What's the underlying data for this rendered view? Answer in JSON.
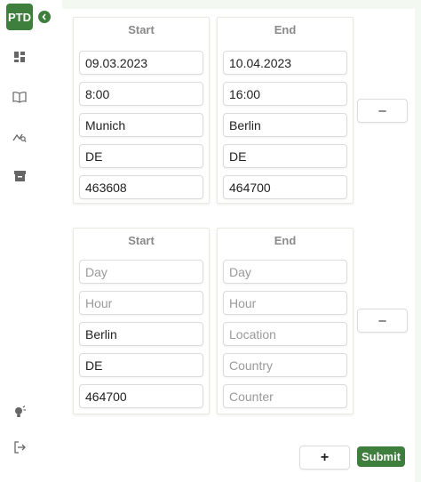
{
  "sidebar": {
    "logo_text": "PTD",
    "collapse_icon": "chevron-left-icon",
    "nav_icons": [
      "dashboard-icon",
      "book-icon",
      "analytics-icon",
      "archive-icon"
    ],
    "bottom_icons": [
      "lightbulb-icon",
      "logout-icon"
    ]
  },
  "trips": [
    {
      "start": {
        "title": "Start",
        "day": {
          "value": "09.03.2023",
          "placeholder": "Day"
        },
        "hour": {
          "value": "8:00",
          "placeholder": "Hour"
        },
        "location": {
          "value": "Munich",
          "placeholder": "Location"
        },
        "country": {
          "value": "DE",
          "placeholder": "Country"
        },
        "counter": {
          "value": "463608",
          "placeholder": "Counter"
        }
      },
      "end": {
        "title": "End",
        "day": {
          "value": "10.04.2023",
          "placeholder": "Day"
        },
        "hour": {
          "value": "16:00",
          "placeholder": "Hour"
        },
        "location": {
          "value": "Berlin",
          "placeholder": "Location"
        },
        "country": {
          "value": "DE",
          "placeholder": "Country"
        },
        "counter": {
          "value": "464700",
          "placeholder": "Counter"
        }
      },
      "remove_label": "–"
    },
    {
      "start": {
        "title": "Start",
        "day": {
          "value": "",
          "placeholder": "Day"
        },
        "hour": {
          "value": "",
          "placeholder": "Hour"
        },
        "location": {
          "value": "Berlin",
          "placeholder": "Location"
        },
        "country": {
          "value": "DE",
          "placeholder": "Country"
        },
        "counter": {
          "value": "464700",
          "placeholder": "Counter"
        }
      },
      "end": {
        "title": "End",
        "day": {
          "value": "",
          "placeholder": "Day"
        },
        "hour": {
          "value": "",
          "placeholder": "Hour"
        },
        "location": {
          "value": "",
          "placeholder": "Location"
        },
        "country": {
          "value": "",
          "placeholder": "Country"
        },
        "counter": {
          "value": "",
          "placeholder": "Counter"
        }
      },
      "remove_label": "–"
    }
  ],
  "actions": {
    "add_label": "+",
    "submit_label": "Submit"
  },
  "colors": {
    "brand": "#3f7f3d",
    "background": "#f3f8f1"
  }
}
